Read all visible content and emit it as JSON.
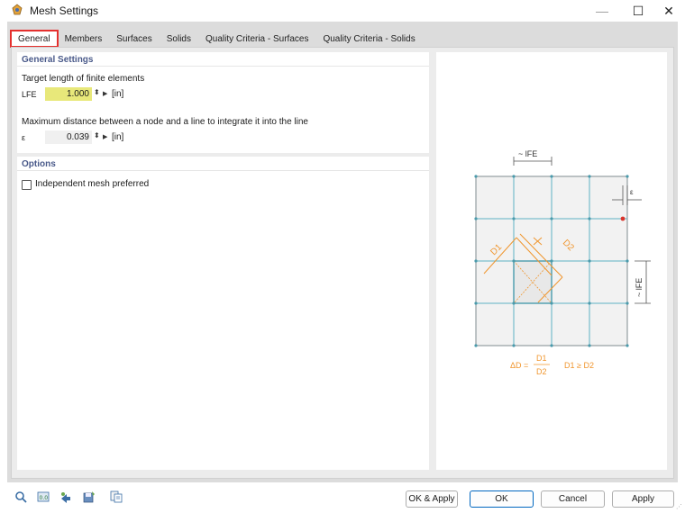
{
  "window": {
    "title": "Mesh Settings",
    "minimize": "—",
    "maximize": "☐",
    "close": "✕"
  },
  "tabs": [
    {
      "label": "General",
      "active": true
    },
    {
      "label": "Members"
    },
    {
      "label": "Surfaces"
    },
    {
      "label": "Solids"
    },
    {
      "label": "Quality Criteria - Surfaces"
    },
    {
      "label": "Quality Criteria - Solids"
    }
  ],
  "general_settings": {
    "title": "General Settings",
    "target_length": {
      "label": "Target length of finite elements",
      "symbol": "LFE",
      "value": "1.000",
      "unit": "[in]"
    },
    "max_distance": {
      "label": "Maximum distance between a node and a line to integrate it into the line",
      "symbol": "ε",
      "value": "0.039",
      "unit": "[in]"
    }
  },
  "options": {
    "title": "Options",
    "independent_mesh": {
      "label": "Independent mesh preferred",
      "checked": false
    }
  },
  "diagram": {
    "top_label": "~ lFE",
    "side_label": "~ lFE",
    "epsilon_label": "ε",
    "d1_label": "D1",
    "d2_label": "D2",
    "formula_lhs": "ΔD =",
    "formula_num": "D1",
    "formula_den": "D2",
    "formula_cond": "D1 ≥ D2",
    "colors": {
      "grid": "#5fb3c4",
      "node": "#4a9aab",
      "accent": "#f0962e",
      "red_node": "#d9342b",
      "fill": "#f2f2f2",
      "border": "#7f8b8f"
    }
  },
  "buttons": {
    "ok_apply": "OK & Apply",
    "ok": "OK",
    "cancel": "Cancel",
    "apply": "Apply"
  },
  "toolbar_icons": [
    "search-icon",
    "units-icon",
    "arrow-icon",
    "save-icon",
    "copy-icon"
  ]
}
